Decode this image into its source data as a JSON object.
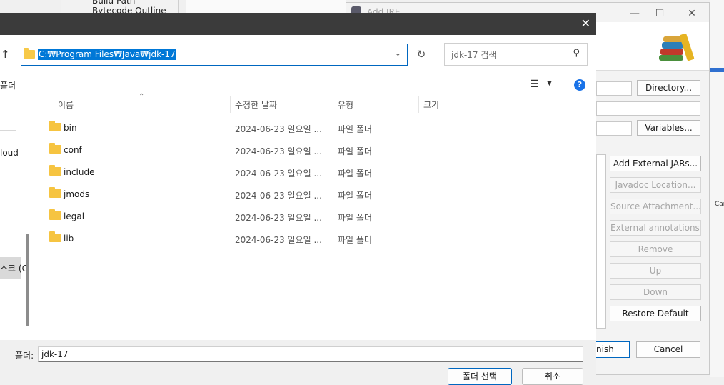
{
  "background": {
    "menu_items": [
      "Build Path",
      "Bytecode Outline"
    ]
  },
  "jre_dialog": {
    "title": "Add JRE",
    "buttons": {
      "directory": "Directory...",
      "variables": "Variables...",
      "add_external_jars": "Add External JARs...",
      "javadoc_location": "Javadoc Location...",
      "source_attachment": "Source Attachment...",
      "external_annotations": "External annotations...",
      "remove": "Remove",
      "up": "Up",
      "down": "Down",
      "restore_default": "Restore Default",
      "finish_partial": "nish",
      "cancel": "Cancel"
    },
    "right_strip_text": "Can"
  },
  "file_dialog": {
    "close_glyph": "✕",
    "address_path": "C:₩Program Files₩Java₩jdk-17",
    "search_placeholder": "jdk-17 검색",
    "toolbar_left_partial": "폴더",
    "left_pane": {
      "cloud_partial": "loud",
      "disk_partial": "스크 (C"
    },
    "columns": [
      "이름",
      "수정한 날짜",
      "유형",
      "크기"
    ],
    "rows": [
      {
        "name": "bin",
        "date": "2024-06-23 일요일 ...",
        "type": "파일 폴더"
      },
      {
        "name": "conf",
        "date": "2024-06-23 일요일 ...",
        "type": "파일 폴더"
      },
      {
        "name": "include",
        "date": "2024-06-23 일요일 ...",
        "type": "파일 폴더"
      },
      {
        "name": "jmods",
        "date": "2024-06-23 일요일 ...",
        "type": "파일 폴더"
      },
      {
        "name": "legal",
        "date": "2024-06-23 일요일 ...",
        "type": "파일 폴더"
      },
      {
        "name": "lib",
        "date": "2024-06-23 일요일 ...",
        "type": "파일 폴더"
      }
    ],
    "folder_label": "폴더:",
    "folder_value": "jdk-17",
    "select_button": "폴더 선택",
    "cancel_button": "취소"
  }
}
